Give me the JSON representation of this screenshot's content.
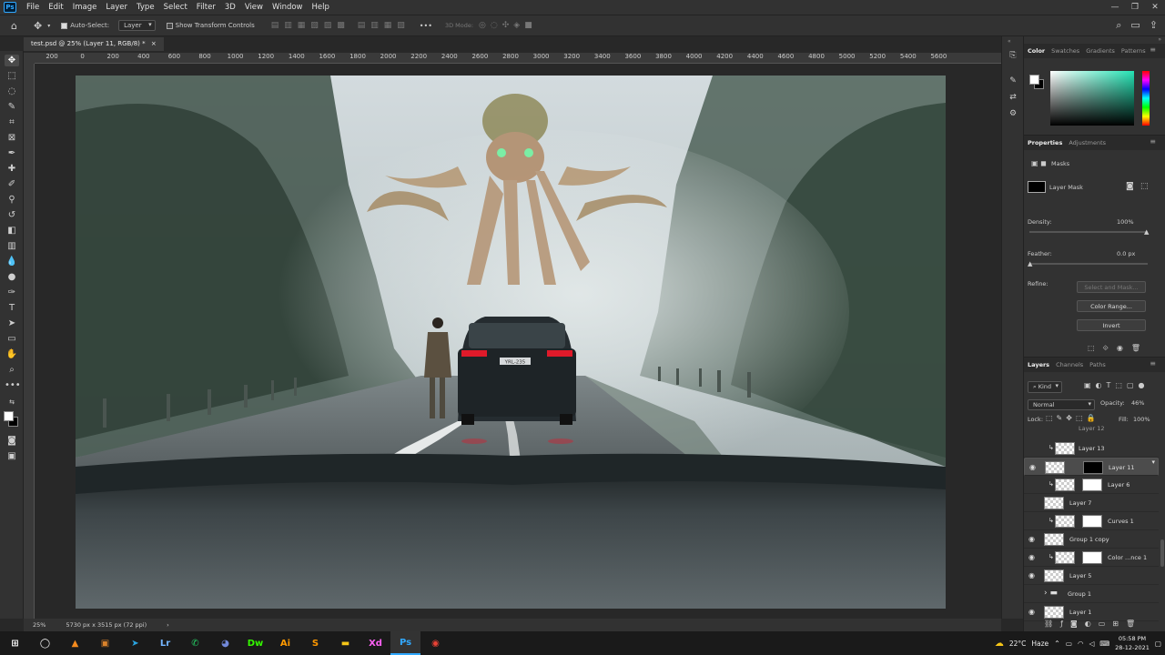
{
  "app": {
    "logo": "Ps"
  },
  "menu": [
    "File",
    "Edit",
    "Image",
    "Layer",
    "Type",
    "Select",
    "Filter",
    "3D",
    "View",
    "Window",
    "Help"
  ],
  "window_controls": {
    "minimize": "—",
    "restore": "❐",
    "close": "✕"
  },
  "options": {
    "auto_select_label": "Auto-Select:",
    "auto_select_checked": true,
    "target_value": "Layer",
    "transform_label": "Show Transform Controls",
    "more": "•••",
    "mode_3d": "3D Mode:"
  },
  "document": {
    "tab_title": "test.psd @ 25% (Layer 11, RGB/8) *",
    "tab_close": "×"
  },
  "ruler_ticks": [
    "200",
    "0",
    "200",
    "400",
    "600",
    "800",
    "1000",
    "1200",
    "1400",
    "1600",
    "1800",
    "2000",
    "2200",
    "2400",
    "2600",
    "2800",
    "3000",
    "3200",
    "3400",
    "3600",
    "3800",
    "4000",
    "4200",
    "4400",
    "4600",
    "4800",
    "5000",
    "5200",
    "5400",
    "5600"
  ],
  "status": {
    "zoom": "25%",
    "doc_size": "5730 px x 3515 px (72 ppi)",
    "arrow": "›"
  },
  "color_panel": {
    "tabs": [
      "Color",
      "Swatches",
      "Gradients",
      "Patterns"
    ],
    "active_tab": "Color",
    "colors": {
      "foreground": "#ffffff",
      "background": "#000000",
      "picker_hue": "#25e4b5"
    }
  },
  "properties": {
    "tabs": [
      "Properties",
      "Adjustments"
    ],
    "section": "Masks",
    "mask_type": "Layer Mask",
    "density_label": "Density:",
    "density_value": "100%",
    "density": 1.0,
    "feather_label": "Feather:",
    "feather_value": "0.0 px",
    "feather": 0.0,
    "refine_label": "Refine:",
    "select_and_mask": "Select and Mask...",
    "color_range": "Color Range...",
    "invert": "Invert"
  },
  "layers_panel": {
    "tabs": [
      "Layers",
      "Channels",
      "Paths"
    ],
    "filter_kind": "Kind",
    "blend_mode": "Normal",
    "opacity_label": "Opacity:",
    "opacity_value": "46%",
    "lock_label": "Lock:",
    "fill_label": "Fill:",
    "fill_value": "100%",
    "partial_top": "Layer 12",
    "layers": [
      {
        "name": "Layer 13",
        "visible": false,
        "clip": true,
        "mask": false,
        "selected": false
      },
      {
        "name": "Layer 11",
        "visible": true,
        "clip": false,
        "mask": true,
        "selected": true
      },
      {
        "name": "Layer 6",
        "visible": false,
        "clip": true,
        "mask": true,
        "selected": false
      },
      {
        "name": "Layer 7",
        "visible": false,
        "clip": false,
        "mask": false,
        "selected": false
      },
      {
        "name": "Curves 1",
        "visible": false,
        "clip": true,
        "mask": true,
        "selected": false
      },
      {
        "name": "Group 1 copy",
        "visible": true,
        "clip": false,
        "mask": false,
        "selected": false
      },
      {
        "name": "Color ...nce 1",
        "visible": true,
        "clip": true,
        "mask": true,
        "selected": false
      },
      {
        "name": "Layer 5",
        "visible": true,
        "clip": false,
        "mask": false,
        "selected": false
      },
      {
        "name": "Group 1",
        "visible": false,
        "clip": false,
        "mask": false,
        "selected": false,
        "group": true
      },
      {
        "name": "Layer 1",
        "visible": true,
        "clip": false,
        "mask": false,
        "selected": false
      }
    ]
  },
  "canvas_image": {
    "plate": "YRL-235"
  },
  "taskbar": {
    "apps": [
      {
        "icon": "vlc-icon",
        "glyph": "▲",
        "color": "#f48a1e"
      },
      {
        "icon": "photos-icon",
        "glyph": "▣",
        "color": "#d9822b"
      },
      {
        "icon": "telegram-icon",
        "glyph": "➤",
        "color": "#2aa3df"
      },
      {
        "icon": "lightroom-icon",
        "glyph": "Lr",
        "color": "#74b5ff"
      },
      {
        "icon": "whatsapp-icon",
        "glyph": "✆",
        "color": "#25d366"
      },
      {
        "icon": "discord-icon",
        "glyph": "◕",
        "color": "#7289da"
      },
      {
        "icon": "dreamweaver-icon",
        "glyph": "Dw",
        "color": "#35fa00"
      },
      {
        "icon": "illustrator-icon",
        "glyph": "Ai",
        "color": "#ff9a00"
      },
      {
        "icon": "sublime-icon",
        "glyph": "S",
        "color": "#ff9800"
      },
      {
        "icon": "file-explorer-icon",
        "glyph": "▬",
        "color": "#f5c518"
      },
      {
        "icon": "xd-icon",
        "glyph": "Xd",
        "color": "#ff61f6"
      },
      {
        "icon": "photoshop-icon",
        "glyph": "Ps",
        "color": "#31a8ff"
      },
      {
        "icon": "chrome-icon",
        "glyph": "◉",
        "color": "#e94235"
      }
    ],
    "weather_temp": "22°C",
    "weather_cond": "Haze",
    "time": "05:58 PM",
    "date": "28-12-2021"
  }
}
